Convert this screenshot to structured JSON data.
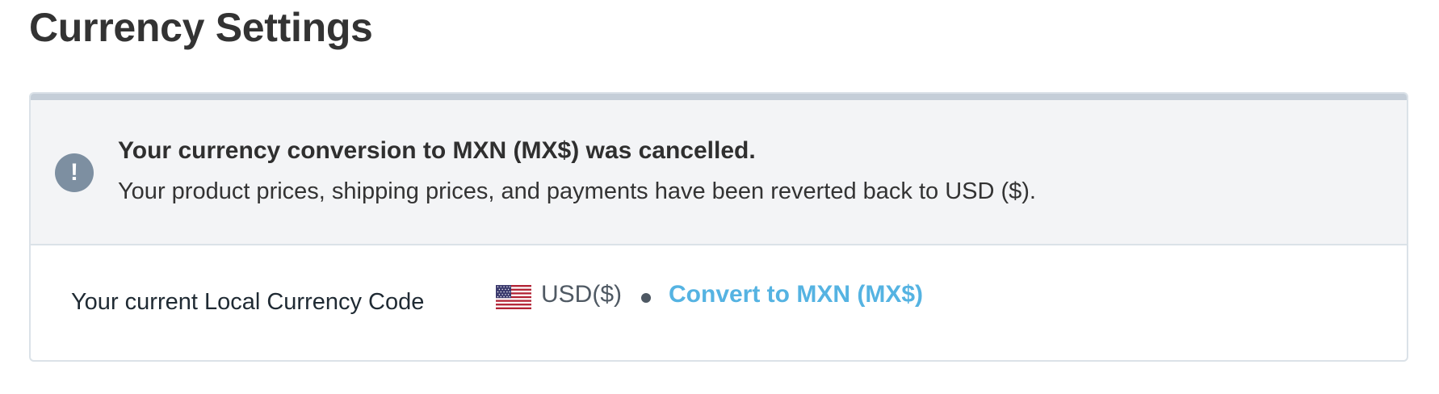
{
  "page": {
    "title": "Currency Settings"
  },
  "alert": {
    "icon": "exclamation-icon",
    "icon_glyph": "!",
    "title": "Your currency conversion to MXN (MX$) was cancelled.",
    "message": "Your product prices, shipping prices, and payments have been reverted back to USD ($)."
  },
  "currency_row": {
    "label": "Your current Local Currency Code",
    "flag_icon": "us-flag-icon",
    "current_code": "USD($)",
    "convert_link": "Convert to MXN (MX$)"
  },
  "colors": {
    "link": "#55b3e2",
    "alert_icon_bg": "#7d8fa1",
    "banner_bg": "#f3f4f6",
    "card_topbar": "#c5ced8"
  }
}
